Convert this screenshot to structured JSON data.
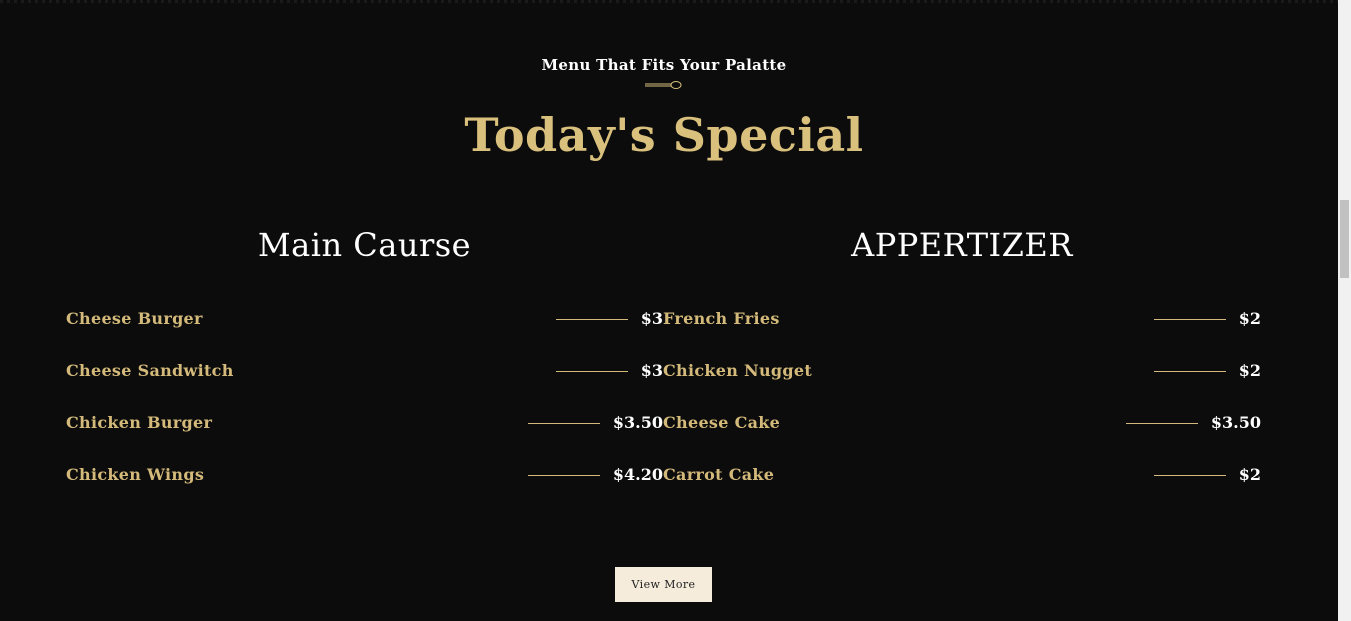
{
  "section": {
    "eyebrow": "Menu That Fits Your Palatte",
    "title": "Today's Special",
    "divider_icon": "spoon-icon",
    "accent_color": "#d9c07d",
    "background_color": "#0c0c0c"
  },
  "columns": [
    {
      "title": "Main Caurse",
      "items": [
        {
          "name": "Cheese Burger",
          "price": "$3"
        },
        {
          "name": "Cheese Sandwitch",
          "price": "$3"
        },
        {
          "name": "Chicken Burger",
          "price": "$3.50"
        },
        {
          "name": "Chicken Wings",
          "price": "$4.20"
        }
      ]
    },
    {
      "title": "APPERTIZER",
      "items": [
        {
          "name": "French Fries",
          "price": "$2"
        },
        {
          "name": "Chicken Nugget",
          "price": "$2"
        },
        {
          "name": "Cheese Cake",
          "price": "$3.50"
        },
        {
          "name": "Carrot Cake",
          "price": "$2"
        }
      ]
    }
  ],
  "actions": {
    "view_more_label": "View More"
  }
}
